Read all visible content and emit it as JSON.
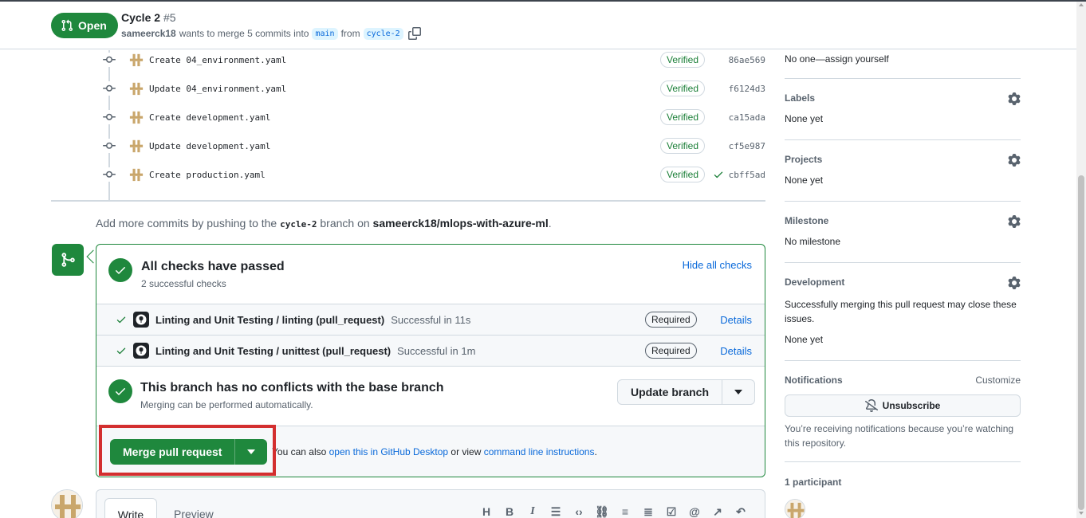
{
  "header": {
    "state_label": "Open",
    "title": "Cycle 2",
    "number": "#5",
    "author": "sameerck18",
    "merge_text": "wants to merge 5 commits into",
    "base_branch": "main",
    "from_text": "from",
    "head_branch": "cycle-2"
  },
  "commits": [
    {
      "message": "Create 04_environment.yaml",
      "badge": "Verified",
      "sha": "86ae569"
    },
    {
      "message": "Update 04_environment.yaml",
      "badge": "Verified",
      "sha": "f6124d3"
    },
    {
      "message": "Create development.yaml",
      "badge": "Verified",
      "sha": "ca15ada"
    },
    {
      "message": "Update development.yaml",
      "badge": "Verified",
      "sha": "cf5e987"
    },
    {
      "message": "Create production.yaml",
      "badge": "Verified",
      "sha": "cbff5ad"
    }
  ],
  "add_more": {
    "prefix": "Add more commits by pushing to the",
    "branch": "cycle-2",
    "middle": "branch on",
    "repo": "sameerck18/mlops-with-azure-ml",
    "suffix": "."
  },
  "checks": {
    "title": "All checks have passed",
    "subtitle": "2 successful checks",
    "hide_label": "Hide all checks",
    "items": [
      {
        "name": "Linting and Unit Testing / linting (pull_request)",
        "status": "Successful in 11s",
        "badge": "Required",
        "link": "Details"
      },
      {
        "name": "Linting and Unit Testing / unittest (pull_request)",
        "status": "Successful in 1m",
        "badge": "Required",
        "link": "Details"
      }
    ]
  },
  "conflicts": {
    "title": "This branch has no conflicts with the base branch",
    "subtitle": "Merging can be performed automatically.",
    "update_label": "Update branch"
  },
  "merge": {
    "button_label": "Merge pull request",
    "hint_prefix": "You can also",
    "desktop_link": "open this in GitHub Desktop",
    "hint_middle": "or view",
    "cli_link": "command line instructions",
    "hint_suffix": "."
  },
  "composer": {
    "tab_write": "Write",
    "tab_preview": "Preview",
    "toolbar": [
      "H",
      "B",
      "I",
      "quote",
      "code",
      "link",
      "ul",
      "ol",
      "tasklist",
      "mention",
      "crossref",
      "undo"
    ]
  },
  "sidebar": {
    "assignees_value": "No one—assign yourself",
    "labels_heading": "Labels",
    "labels_value": "None yet",
    "projects_heading": "Projects",
    "projects_value": "None yet",
    "milestone_heading": "Milestone",
    "milestone_value": "No milestone",
    "development_heading": "Development",
    "development_text": "Successfully merging this pull request may close these issues.",
    "development_value": "None yet",
    "notifications_heading": "Notifications",
    "customize_label": "Customize",
    "unsubscribe_label": "Unsubscribe",
    "notifications_text": "You’re receiving notifications because you’re watching this repository.",
    "participants_heading": "1 participant"
  },
  "colors": {
    "success": "#1f883d",
    "link": "#0969da",
    "highlight": "#d32f2f"
  }
}
